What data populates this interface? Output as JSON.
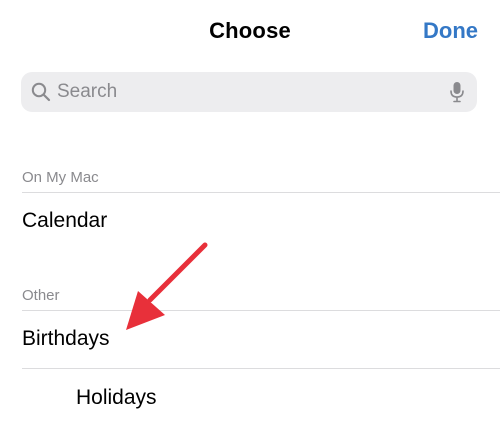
{
  "nav": {
    "title": "Choose",
    "done_label": "Done"
  },
  "search": {
    "placeholder": "Search",
    "value": "",
    "search_icon": "magnifying-glass-icon",
    "mic_icon": "microphone-icon"
  },
  "sections": {
    "on_my_mac": {
      "header": "On My Mac",
      "items": [
        "Calendar"
      ]
    },
    "other": {
      "header": "Other",
      "items": [
        "Birthdays",
        "Holidays"
      ]
    }
  },
  "colors": {
    "accent": "#3478c6",
    "annotation_arrow": "#e8303a",
    "search_background": "#ededef",
    "secondary_text": "#8a8a8e"
  }
}
